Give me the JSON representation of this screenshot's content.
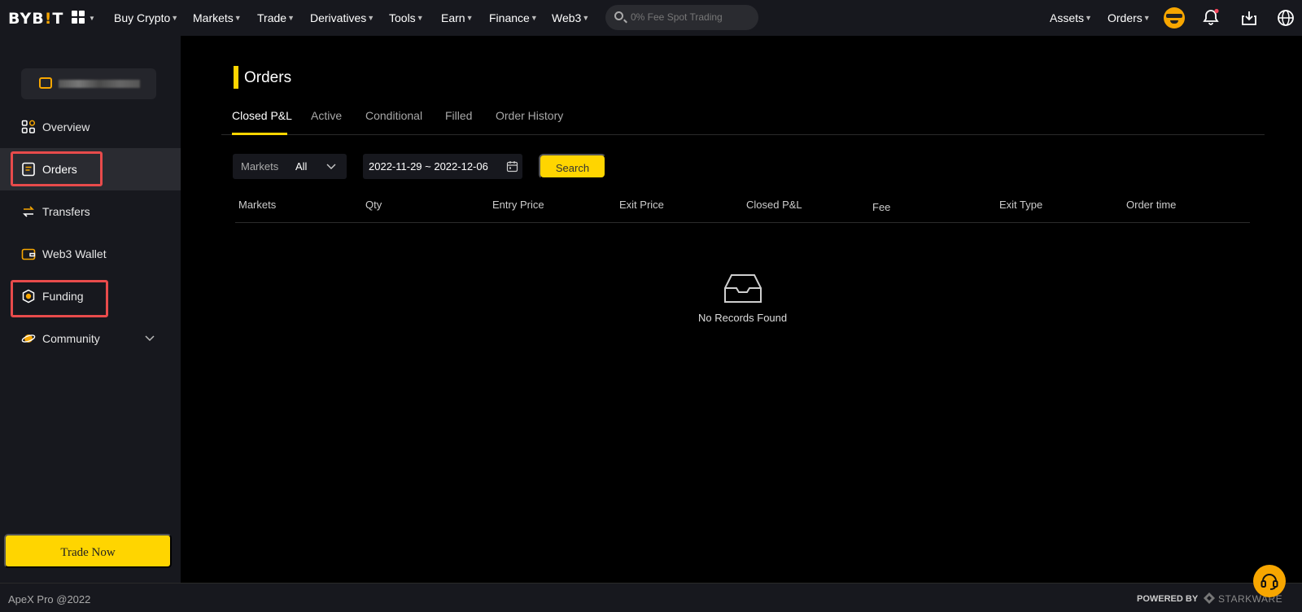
{
  "topnav": {
    "logo_prefix": "BYB",
    "logo_bang": "!",
    "logo_suffix": "T",
    "menu": [
      {
        "label": "Buy Crypto"
      },
      {
        "label": "Markets"
      },
      {
        "label": "Trade"
      },
      {
        "label": "Derivatives"
      },
      {
        "label": "Tools"
      },
      {
        "label": "Earn"
      },
      {
        "label": "Finance"
      },
      {
        "label": "Web3"
      }
    ],
    "search_placeholder": "0% Fee Spot Trading",
    "assets_label": "Assets",
    "orders_label": "Orders",
    "caret": "▼",
    "icons": [
      "apps-grid-icon",
      "search-icon",
      "avatar",
      "bell-icon",
      "download-icon",
      "globe-icon"
    ],
    "notification_dot_color": "#f6465d"
  },
  "sidebar": {
    "account_name": "",
    "items": [
      {
        "label": "Overview",
        "icon": "overview-icon"
      },
      {
        "label": "Orders",
        "icon": "orders-icon",
        "active": true
      },
      {
        "label": "Transfers",
        "icon": "transfers-icon"
      },
      {
        "label": "Web3 Wallet",
        "icon": "wallet-icon"
      },
      {
        "label": "Funding",
        "icon": "funding-icon"
      },
      {
        "label": "Community",
        "icon": "community-icon",
        "expandable": true
      }
    ],
    "trade_now_label": "Trade Now"
  },
  "main": {
    "title": "Orders",
    "tabs": [
      {
        "label": "Closed P&L",
        "active": true
      },
      {
        "label": "Active"
      },
      {
        "label": "Conditional"
      },
      {
        "label": "Filled"
      },
      {
        "label": "Order History"
      }
    ],
    "filters": {
      "markets_label": "Markets",
      "markets_value": "All",
      "date_range": "2022-11-29 ~ 2022-12-06",
      "search_label": "Search"
    },
    "table": {
      "columns": [
        "Markets",
        "Qty",
        "Entry Price",
        "Exit Price",
        "Closed P&L",
        "Fee",
        "Exit Type",
        "Order time"
      ],
      "rows": []
    },
    "empty_text": "No Records Found"
  },
  "footer": {
    "copyright": "ApeX Pro @2022",
    "powered_by": "POWERED BY",
    "partner": "STARKWARE"
  },
  "colors": {
    "accent": "#ffd500",
    "brand_orange": "#f7a600",
    "highlight_box": "#e84b4b",
    "background": "#000000",
    "panel": "#17181e"
  }
}
